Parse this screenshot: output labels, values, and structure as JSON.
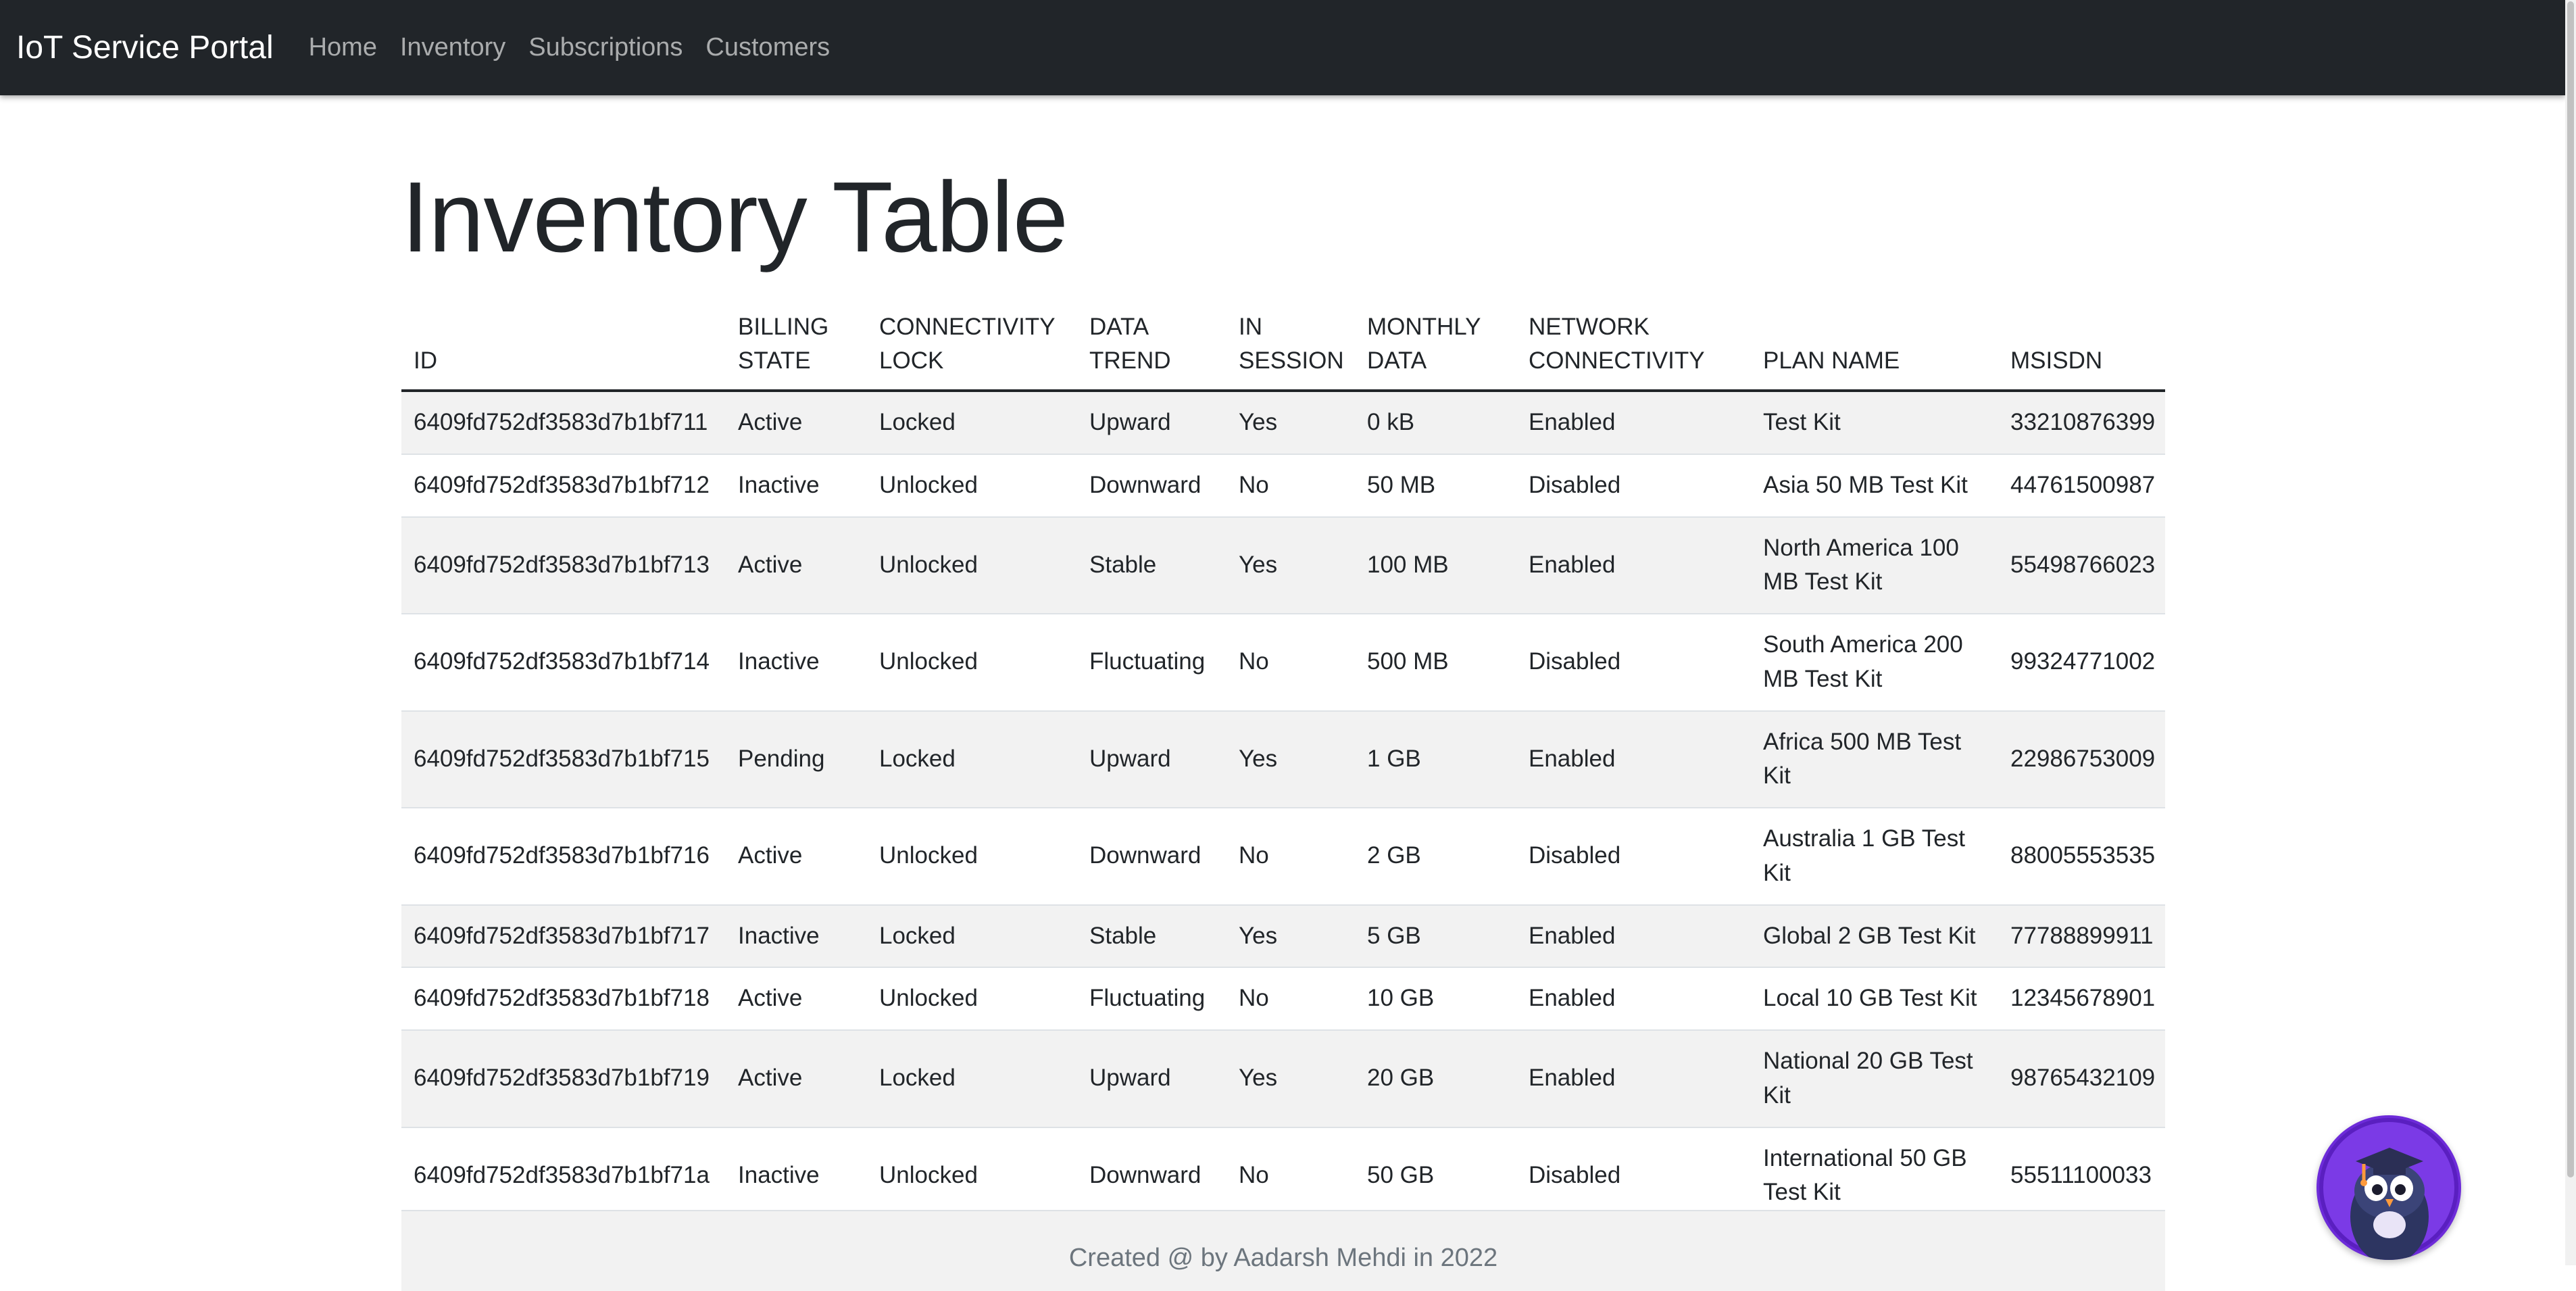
{
  "navbar": {
    "brand": "IoT Service Portal",
    "links": [
      "Home",
      "Inventory",
      "Subscriptions",
      "Customers"
    ]
  },
  "page": {
    "title": "Inventory Table"
  },
  "table": {
    "headers": [
      "ID",
      "BILLING STATE",
      "CONNECTIVITY LOCK",
      "DATA TREND",
      "IN SESSION",
      "MONTHLY DATA",
      "NETWORK CONNECTIVITY",
      "PLAN NAME",
      "MSISDN"
    ],
    "rows": [
      [
        "6409fd752df3583d7b1bf711",
        "Active",
        "Locked",
        "Upward",
        "Yes",
        "0 kB",
        "Enabled",
        "Test Kit",
        "33210876399"
      ],
      [
        "6409fd752df3583d7b1bf712",
        "Inactive",
        "Unlocked",
        "Downward",
        "No",
        "50 MB",
        "Disabled",
        "Asia 50 MB Test Kit",
        "44761500987"
      ],
      [
        "6409fd752df3583d7b1bf713",
        "Active",
        "Unlocked",
        "Stable",
        "Yes",
        "100 MB",
        "Enabled",
        "North America 100 MB Test Kit",
        "55498766023"
      ],
      [
        "6409fd752df3583d7b1bf714",
        "Inactive",
        "Unlocked",
        "Fluctuating",
        "No",
        "500 MB",
        "Disabled",
        "South America 200 MB Test Kit",
        "99324771002"
      ],
      [
        "6409fd752df3583d7b1bf715",
        "Pending",
        "Locked",
        "Upward",
        "Yes",
        "1 GB",
        "Enabled",
        "Africa 500 MB Test Kit",
        "22986753009"
      ],
      [
        "6409fd752df3583d7b1bf716",
        "Active",
        "Unlocked",
        "Downward",
        "No",
        "2 GB",
        "Disabled",
        "Australia 1 GB Test Kit",
        "88005553535"
      ],
      [
        "6409fd752df3583d7b1bf717",
        "Inactive",
        "Locked",
        "Stable",
        "Yes",
        "5 GB",
        "Enabled",
        "Global 2 GB Test Kit",
        "77788899911"
      ],
      [
        "6409fd752df3583d7b1bf718",
        "Active",
        "Unlocked",
        "Fluctuating",
        "No",
        "10 GB",
        "Enabled",
        "Local 10 GB Test Kit",
        "12345678901"
      ],
      [
        "6409fd752df3583d7b1bf719",
        "Active",
        "Locked",
        "Upward",
        "Yes",
        "20 GB",
        "Enabled",
        "National 20 GB Test Kit",
        "98765432109"
      ],
      [
        "6409fd752df3583d7b1bf71a",
        "Inactive",
        "Unlocked",
        "Downward",
        "No",
        "50 GB",
        "Disabled",
        "International 50 GB Test Kit",
        "55511100033"
      ]
    ]
  },
  "footer": {
    "text": "Created @ by Aadarsh Mehdi in 2022"
  },
  "mascot": {
    "icon": "owl-mascot-icon",
    "background": "#6d2bd9"
  },
  "colors": {
    "navbar": "#212529",
    "stripe": "#f2f2f2"
  }
}
